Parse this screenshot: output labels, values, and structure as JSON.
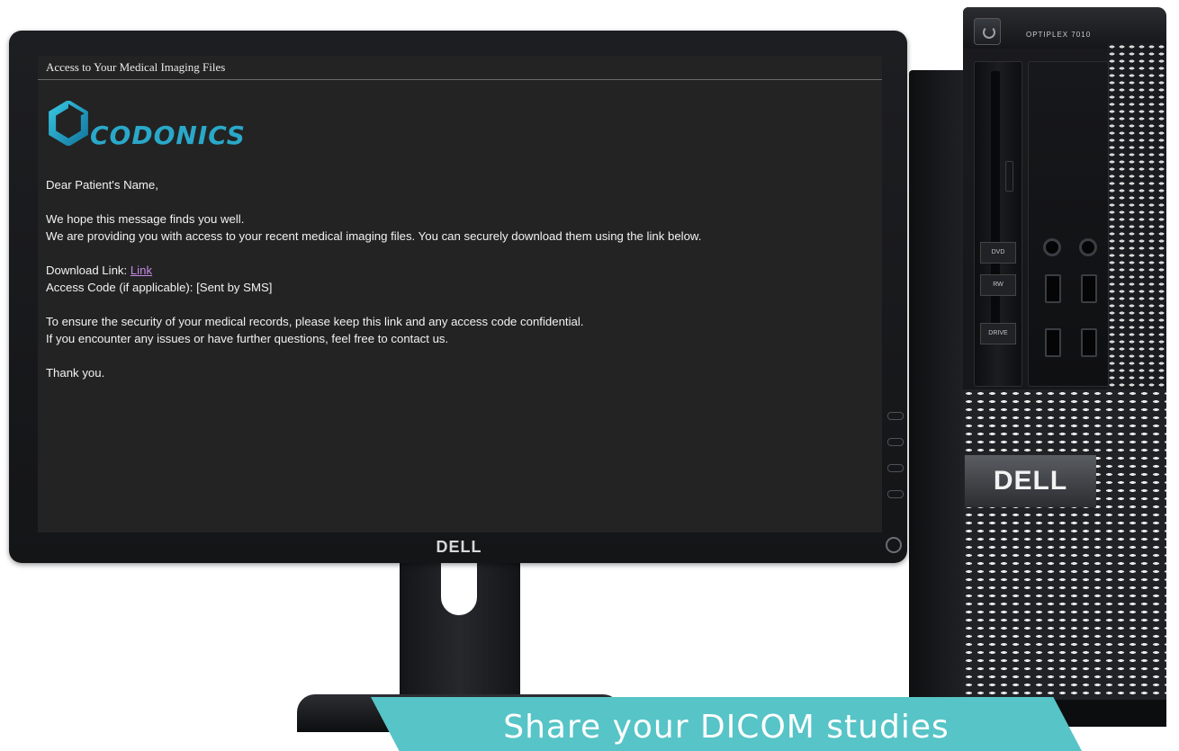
{
  "tower": {
    "model": "OPTIPLEX 7010",
    "brand": "DELL",
    "bay_badges": [
      "DVD",
      "RW",
      "DRIVE"
    ]
  },
  "monitor": {
    "brand": "DELL"
  },
  "email": {
    "subject": "Access to Your Medical Imaging Files",
    "logo_text": "CODONICS",
    "greeting": "Dear Patient's Name,",
    "line1": "We hope this message finds you well.",
    "line2": "We are providing you with access to your recent medical imaging files. You can securely download them using the link below.",
    "download_label": "Download Link: ",
    "download_link_text": "Link",
    "access_code": "Access Code (if applicable): [Sent by SMS]",
    "security_note": "To ensure the security of your medical records, please keep this link and any access code confidential.",
    "contact_note": "If you encounter any issues or have further questions, feel free to contact us.",
    "closing": "Thank you."
  },
  "banner": {
    "text": "Share your DICOM studies"
  },
  "colors": {
    "brand_teal": "#2aa8c9",
    "link": "#c58be6",
    "banner": "#57c4c7",
    "screen_bg": "#232323"
  }
}
